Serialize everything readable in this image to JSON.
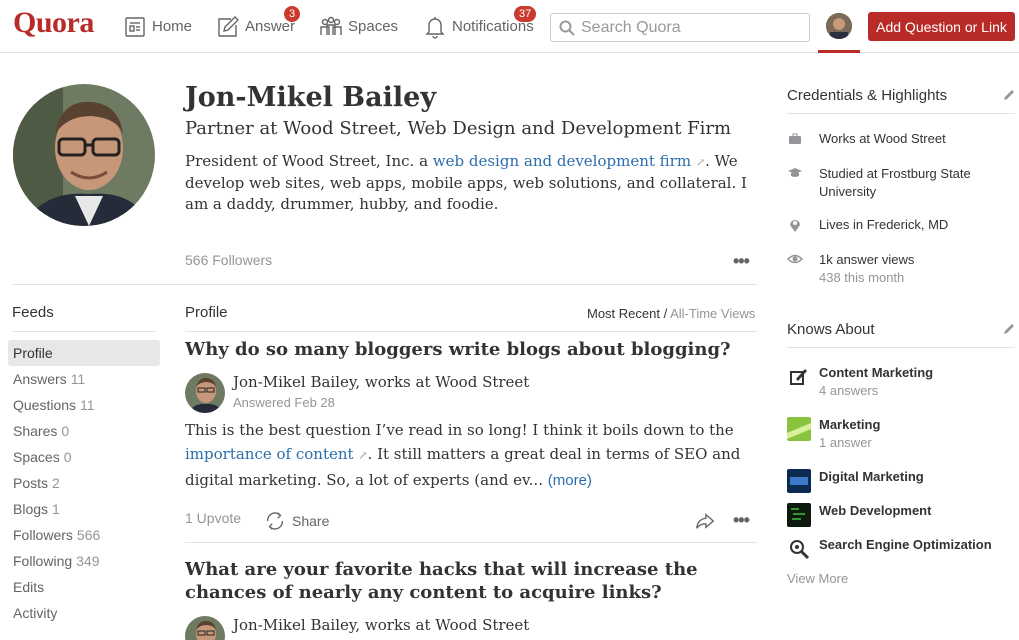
{
  "header": {
    "logo": "Quora",
    "nav": [
      {
        "label": "Home",
        "icon": "home-icon"
      },
      {
        "label": "Answer",
        "icon": "answer-icon",
        "badge": "3"
      },
      {
        "label": "Spaces",
        "icon": "spaces-icon"
      },
      {
        "label": "Notifications",
        "icon": "bell-icon",
        "badge": "37"
      }
    ],
    "search_placeholder": "Search Quora",
    "add_button": "Add Question or Link"
  },
  "profile": {
    "name": "Jon-Mikel Bailey",
    "tagline": "Partner at Wood Street, Web Design and Development Firm",
    "bio_pre": "President of Wood Street, Inc. a ",
    "bio_link": "web design and development firm",
    "bio_post": ". We develop web sites, web apps, mobile apps, web solutions, and collateral. I am a daddy, drummer, hubby, and foodie.",
    "followers": "566 Followers"
  },
  "feeds": {
    "title": "Feeds",
    "items": [
      {
        "label": "Profile",
        "count": ""
      },
      {
        "label": "Answers",
        "count": "11"
      },
      {
        "label": "Questions",
        "count": "11"
      },
      {
        "label": "Shares",
        "count": "0"
      },
      {
        "label": "Spaces",
        "count": "0"
      },
      {
        "label": "Posts",
        "count": "2"
      },
      {
        "label": "Blogs",
        "count": "1"
      },
      {
        "label": "Followers",
        "count": "566"
      },
      {
        "label": "Following",
        "count": "349"
      },
      {
        "label": "Edits",
        "count": ""
      },
      {
        "label": "Activity",
        "count": ""
      }
    ]
  },
  "main": {
    "title": "Profile",
    "sort_active": "Most Recent",
    "sort_sep": " / ",
    "sort_alt": "All-Time Views",
    "posts": [
      {
        "question": "Why do so many bloggers write blogs about blogging?",
        "author": "Jon-Mikel Bailey, works at Wood Street",
        "date": "Answered Feb 28",
        "text_pre": "This is the best question I’ve read in so long! I think it boils down to the ",
        "text_link": "importance of content",
        "text_post": ". It still matters a great deal in terms of SEO and digital marketing. So, a lot of experts (and ev... ",
        "more": "(more)",
        "upvote": "1 Upvote",
        "share": "Share"
      },
      {
        "question": "What are your favorite hacks that will increase the chances of nearly any content to acquire links?",
        "author": "Jon-Mikel Bailey, works at Wood Street"
      }
    ]
  },
  "credentials": {
    "title": "Credentials & Highlights",
    "items": [
      {
        "icon": "briefcase-icon",
        "text": "Works at Wood Street",
        "sub": ""
      },
      {
        "icon": "graduation-cap-icon",
        "text": "Studied at Frostburg State University",
        "sub": ""
      },
      {
        "icon": "location-pin-icon",
        "text": "Lives in Frederick, MD",
        "sub": ""
      },
      {
        "icon": "eye-icon",
        "text": "1k answer views",
        "sub": "438 this month"
      }
    ]
  },
  "knows_about": {
    "title": "Knows About",
    "topics": [
      {
        "name": "Content Marketing",
        "sub": "4 answers"
      },
      {
        "name": "Marketing",
        "sub": "1 answer"
      },
      {
        "name": "Digital Marketing",
        "sub": ""
      },
      {
        "name": "Web Development",
        "sub": ""
      },
      {
        "name": "Search Engine Optimization",
        "sub": ""
      }
    ],
    "view_more": "View More"
  },
  "colors": {
    "brand": "#b92b27",
    "link": "#2b6dad",
    "muted": "#939598"
  }
}
